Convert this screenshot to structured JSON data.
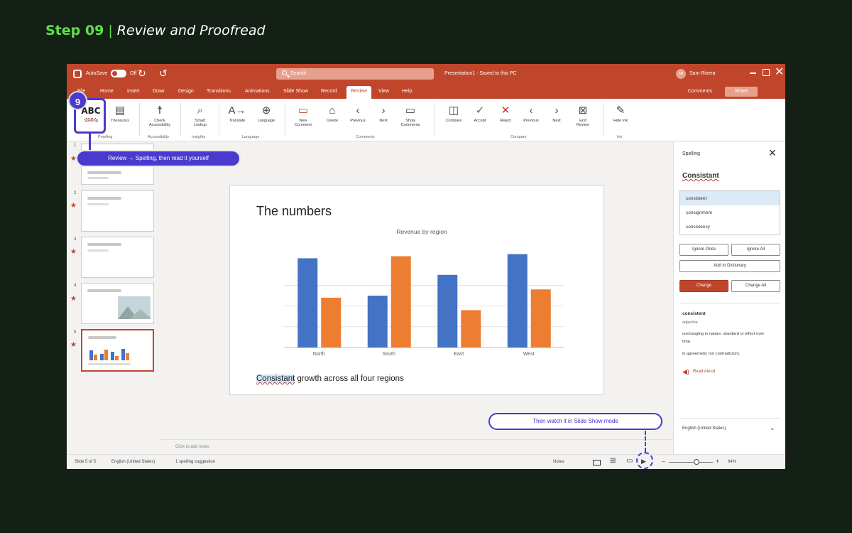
{
  "step": {
    "number": "Step 09",
    "separator": "|",
    "title": "Review and Proofread"
  },
  "titlebar": {
    "autosave": "AutoSave",
    "autosave_state": "Off",
    "search_placeholder": "Search",
    "doc_title": "Presentation1 · Saved to this PC",
    "user_initials": "SR",
    "user_name": "Sam Rivera"
  },
  "tabs": [
    "File",
    "Home",
    "Insert",
    "Draw",
    "Design",
    "Transitions",
    "Animations",
    "Slide Show",
    "Record",
    "Review",
    "View",
    "Help"
  ],
  "active_tab": "Review",
  "tab_actions": {
    "comments": "Comments",
    "share": "Share"
  },
  "ribbon": {
    "spelling": "Spelling",
    "spelling_icon_text": "ABC",
    "thesaurus": "Thesaurus",
    "check_accessibility_1": "Check",
    "check_accessibility_2": "Accessibility",
    "smart_lookup_1": "Smart",
    "smart_lookup_2": "Lookup",
    "translate": "Translate",
    "language": "Language",
    "new_comment_1": "New",
    "new_comment_2": "Comment",
    "delete": "Delete",
    "previous": "Previous",
    "next": "Next",
    "show_comments": "Show Comments",
    "compare": "Compare",
    "accept": "Accept",
    "reject": "Reject",
    "previous_2": "Previous",
    "next_2": "Next",
    "end_review_1": "End",
    "end_review_2": "Review",
    "hide_ink": "Hide Ink",
    "groups": {
      "proofing": "Proofing",
      "accessibility": "Accessibility",
      "insights": "Insights",
      "language": "Language",
      "comments": "Comments",
      "compare": "Compare",
      "ink": "Ink"
    }
  },
  "thumbnails": [
    "1",
    "2",
    "3",
    "4",
    "5"
  ],
  "slide": {
    "title": "The numbers",
    "body_misspelled": "Consistant",
    "body_rest": " growth across all four regions"
  },
  "chart_data": {
    "type": "bar",
    "title": "Revenue by region",
    "categories": [
      "North",
      "South",
      "East",
      "West"
    ],
    "series": [
      {
        "values": [
          43,
          25,
          35,
          45
        ],
        "color": "#4472c4"
      },
      {
        "values": [
          24,
          44,
          18,
          28
        ],
        "color": "#ed7d31"
      }
    ],
    "ylim": [
      0,
      50
    ],
    "grid": true
  },
  "notes_placeholder": "Click to add notes",
  "status": {
    "slide": "Slide 5 of 5",
    "language": "English (United States)",
    "spelling": "1 spelling suggestion",
    "notes": "Notes",
    "zoom": "64%"
  },
  "spelling_pane": {
    "title": "Spelling",
    "word": "Consistant",
    "suggestions": [
      "consistent",
      "consignment",
      "consistency"
    ],
    "ignore_once": "Ignore Once",
    "ignore_all": "Ignore All",
    "add_dictionary": "Add to Dictionary",
    "change": "Change",
    "change_all": "Change All",
    "def_word": "consistent",
    "def_pos": "adjective",
    "def_1": "unchanging in nature, standard or effect over time.",
    "def_2": "in agreement; not contradictory.",
    "read_aloud": "Read Aloud",
    "language": "English (United States)"
  },
  "annotations": {
    "badge": "9",
    "callout_1": "Review → Spelling, then read it yourself",
    "callout_2": "Then watch it in Slide Show mode"
  },
  "colors": {
    "accent": "#c0462b",
    "annotation": "#4a3acf",
    "background": "#141f15",
    "step_green": "#5ee04a"
  }
}
